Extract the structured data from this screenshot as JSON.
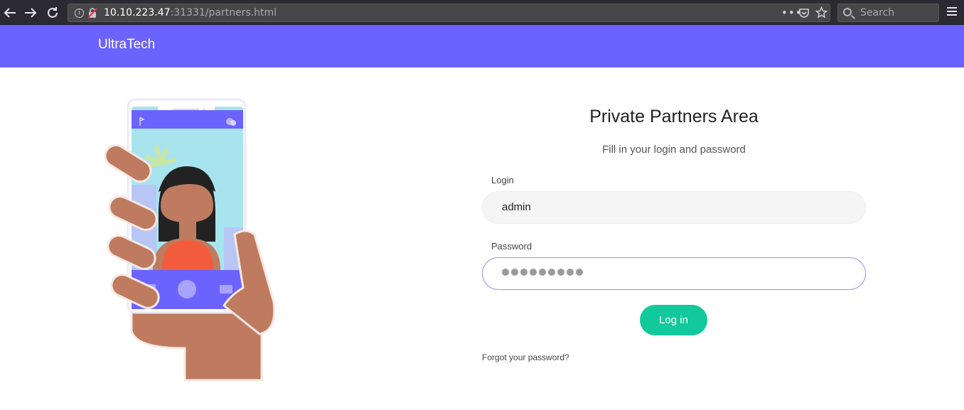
{
  "browser": {
    "url_host": "10.10.223.47",
    "url_rest": ":31331/partners.html",
    "search_placeholder": "Search",
    "icons": [
      "back-arrow-icon",
      "forward-arrow-icon",
      "reload-icon",
      "info-icon",
      "insecure-lock-icon",
      "more-dots-icon",
      "pocket-icon",
      "bookmark-star-icon",
      "search-icon",
      "hamburger-menu-icon"
    ]
  },
  "header": {
    "brand": "UltraTech",
    "color": "#6c63ff"
  },
  "login": {
    "title": "Private Partners Area",
    "subtitle": "Fill in your login and password",
    "login_label": "Login",
    "login_value": "admin",
    "password_label": "Password",
    "password_masked_length": 9,
    "submit_label": "Log in",
    "forgot_link": "Forgot your password?",
    "accent": "#11c99a"
  }
}
